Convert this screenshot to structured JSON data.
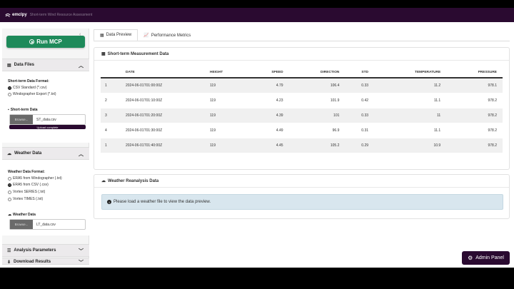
{
  "topbar": {
    "brand": "emclpy",
    "subtitle": "Short-term Wind Resource Assessment"
  },
  "sidebar": {
    "collapse_glyph": "‹",
    "run_button": "Run MCP",
    "data_files": {
      "title": "Data Files",
      "format_label": "Short-term Data Format:",
      "options": [
        "CSV Standard (*.csv)",
        "Windographer Export (*.txt)"
      ],
      "selected": 0,
      "upload_label": "Short-term Data",
      "browse": "Browse...",
      "filename": "ST_data.csv",
      "progress": "Upload complete"
    },
    "weather_data": {
      "title": "Weather Data",
      "format_label": "Weather Data Format:",
      "options": [
        "ERA5 from Windographer (.txt)",
        "ERA5 from CSV (.csv)",
        "Vortex SERIES (.txt)",
        "Vortex TIMES (.txt)"
      ],
      "selected": 1,
      "upload_label": "Weather Data",
      "browse": "Browse...",
      "filename": "LT_data.csv"
    },
    "analysis_parameters": "Analysis Parameters",
    "download_results": "Download Results"
  },
  "tabs": [
    {
      "label": "Data Preview",
      "icon": "table-icon",
      "active": true
    },
    {
      "label": "Performance Metrics",
      "icon": "chart-icon",
      "active": false
    }
  ],
  "short_term": {
    "title": "Short-term Measurement Data",
    "columns": [
      "",
      "DATE",
      "HEIGHT",
      "SPEED",
      "DIRECTION",
      "STD",
      "TEMPERATURE",
      "PRESSURE"
    ],
    "rows": [
      [
        "1",
        "2024-06-01T01:00:00Z",
        "119",
        "4.79",
        "106.4",
        "0.33",
        "11.2",
        "978.1"
      ],
      [
        "2",
        "2024-06-01T01:10:00Z",
        "119",
        "4.23",
        "101.9",
        "0.42",
        "11.1",
        "978.2"
      ],
      [
        "3",
        "2024-06-01T01:20:00Z",
        "119",
        "4.39",
        "101",
        "0.33",
        "11",
        "978.2"
      ],
      [
        "4",
        "2024-06-01T01:30:00Z",
        "119",
        "4.49",
        "96.9",
        "0.31",
        "11.1",
        "978.2"
      ],
      [
        "1",
        "2024-06-01T01:40:00Z",
        "119",
        "4.45",
        "105.2",
        "0.29",
        "10.9",
        "978.2"
      ]
    ]
  },
  "weather": {
    "title": "Weather Reanalysis Data",
    "notice": "Please load a weather file to view the data preview."
  },
  "admin_button": "Admin Panel"
}
